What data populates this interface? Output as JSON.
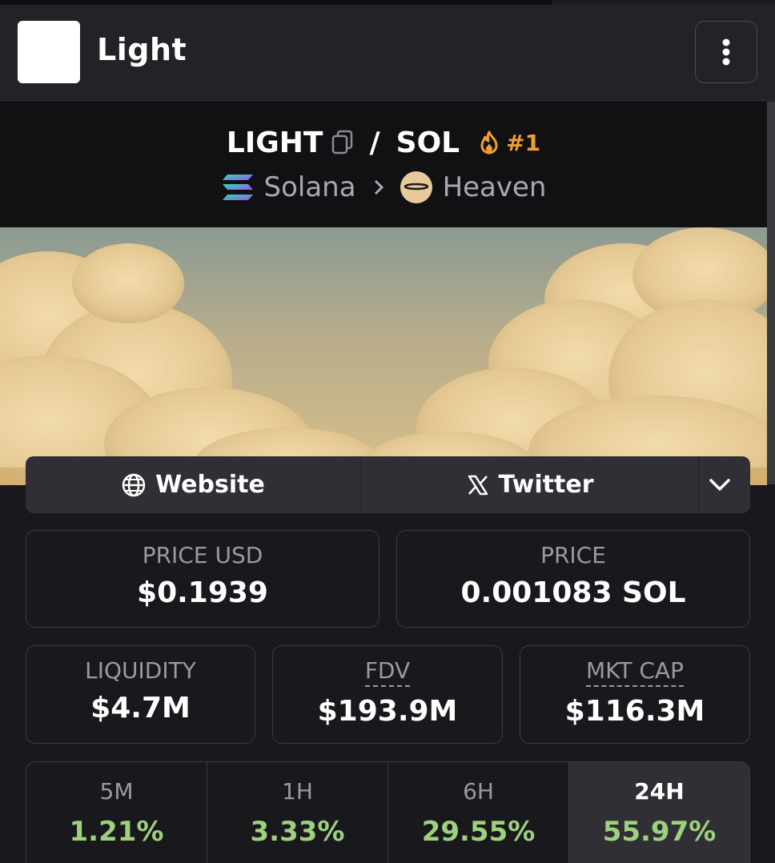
{
  "header": {
    "title": "Light",
    "menu_icon": "more-vertical-icon"
  },
  "pair": {
    "base": "LIGHT",
    "separator": "/",
    "quote": "SOL",
    "rank": "#1",
    "rank_icon": "flame-icon",
    "chain": "Solana",
    "dex": "Heaven",
    "accent_color": "#f0a030"
  },
  "links": {
    "website_label": "Website",
    "twitter_label": "Twitter"
  },
  "stats": {
    "price_usd_label": "PRICE USD",
    "price_usd_value": "$0.1939",
    "price_label": "PRICE",
    "price_value": "0.001083 SOL",
    "liquidity_label": "LIQUIDITY",
    "liquidity_value": "$4.7M",
    "fdv_label": "FDV",
    "fdv_value": "$193.9M",
    "mktcap_label": "MKT CAP",
    "mktcap_value": "$116.3M"
  },
  "changes": [
    {
      "label": "5M",
      "value": "1.21%"
    },
    {
      "label": "1H",
      "value": "3.33%"
    },
    {
      "label": "6H",
      "value": "29.55%"
    },
    {
      "label": "24H",
      "value": "55.97%"
    }
  ],
  "colors": {
    "positive": "#9dd17c",
    "background": "#19181d"
  }
}
